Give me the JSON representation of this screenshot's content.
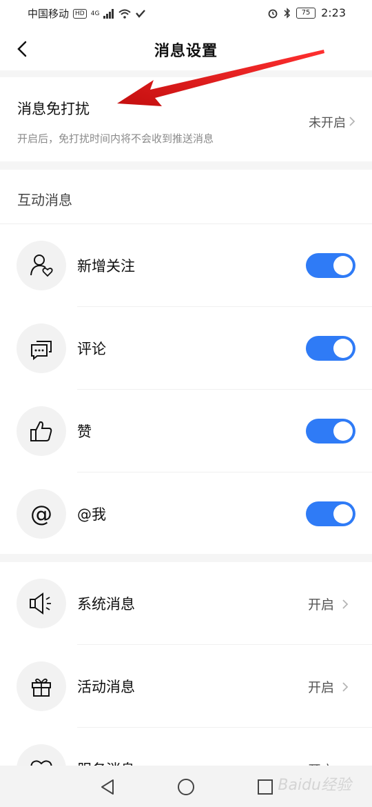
{
  "status": {
    "carrier": "中国移动",
    "hd": "HD",
    "network": "4G",
    "battery": "75",
    "time": "2:23"
  },
  "header": {
    "title": "消息设置"
  },
  "dnd": {
    "title": "消息免打扰",
    "description": "开启后，免打扰时间内将不会收到推送消息",
    "value": "未开启"
  },
  "interaction_section": {
    "title": "互动消息",
    "items": [
      {
        "label": "新增关注",
        "icon": "follow-icon",
        "enabled": true
      },
      {
        "label": "评论",
        "icon": "comment-icon",
        "enabled": true
      },
      {
        "label": "赞",
        "icon": "thumbs-up-icon",
        "enabled": true
      },
      {
        "label": "@我",
        "icon": "at-icon",
        "enabled": true
      }
    ]
  },
  "other_section": {
    "items": [
      {
        "label": "系统消息",
        "icon": "speaker-icon",
        "value": "开启"
      },
      {
        "label": "活动消息",
        "icon": "gift-icon",
        "value": "开启"
      },
      {
        "label": "服务消息",
        "icon": "heart-icon",
        "value": "开启"
      }
    ]
  },
  "colors": {
    "accent": "#2f7bf6",
    "annotation_arrow": "#e21b1b"
  },
  "watermark": "Baidu经验"
}
